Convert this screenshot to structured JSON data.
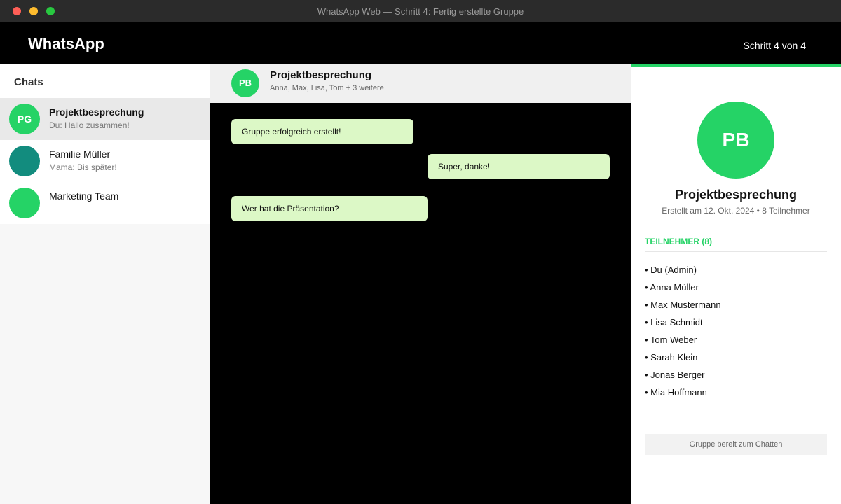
{
  "window": {
    "title": "WhatsApp Web — Schritt 4: Fertig erstellte Gruppe"
  },
  "header": {
    "brand": "WhatsApp",
    "step": "Schritt 4 von 4"
  },
  "colors": {
    "accent": "#25d366",
    "teal": "#128c7e",
    "bubble": "#dcf8c6"
  },
  "sidebar": {
    "title": "Chats",
    "items": [
      {
        "initials": "PG",
        "name": "Projektbesprechung",
        "preview": "Du: Hallo zusammen!",
        "active": true
      },
      {
        "initials": "",
        "name": "Familie Müller",
        "preview": "Mama: Bis später!",
        "active": false
      },
      {
        "initials": "",
        "name": "Marketing Team",
        "preview": "",
        "active": false
      }
    ]
  },
  "chat": {
    "initials": "PB",
    "title": "Projektbesprechung",
    "subtitle": "Anna, Max, Lisa, Tom + 3 weitere",
    "messages": [
      {
        "text": "Gruppe erfolgreich erstellt!",
        "side": "left"
      },
      {
        "text": "Super, danke!",
        "side": "right"
      },
      {
        "text": "Wer hat die Präsentation?",
        "side": "left"
      }
    ]
  },
  "info": {
    "initials": "PB",
    "title": "Projektbesprechung",
    "meta": "Erstellt am 12. Okt. 2024 • 8 Teilnehmer",
    "members_heading": "TEILNEHMER (8)",
    "members": [
      "• Du (Admin)",
      "• Anna Müller",
      "• Max Mustermann",
      "• Lisa Schmidt",
      "• Tom Weber",
      "• Sarah Klein",
      "• Jonas Berger",
      "• Mia Hoffmann"
    ],
    "status": "Gruppe bereit zum Chatten"
  }
}
